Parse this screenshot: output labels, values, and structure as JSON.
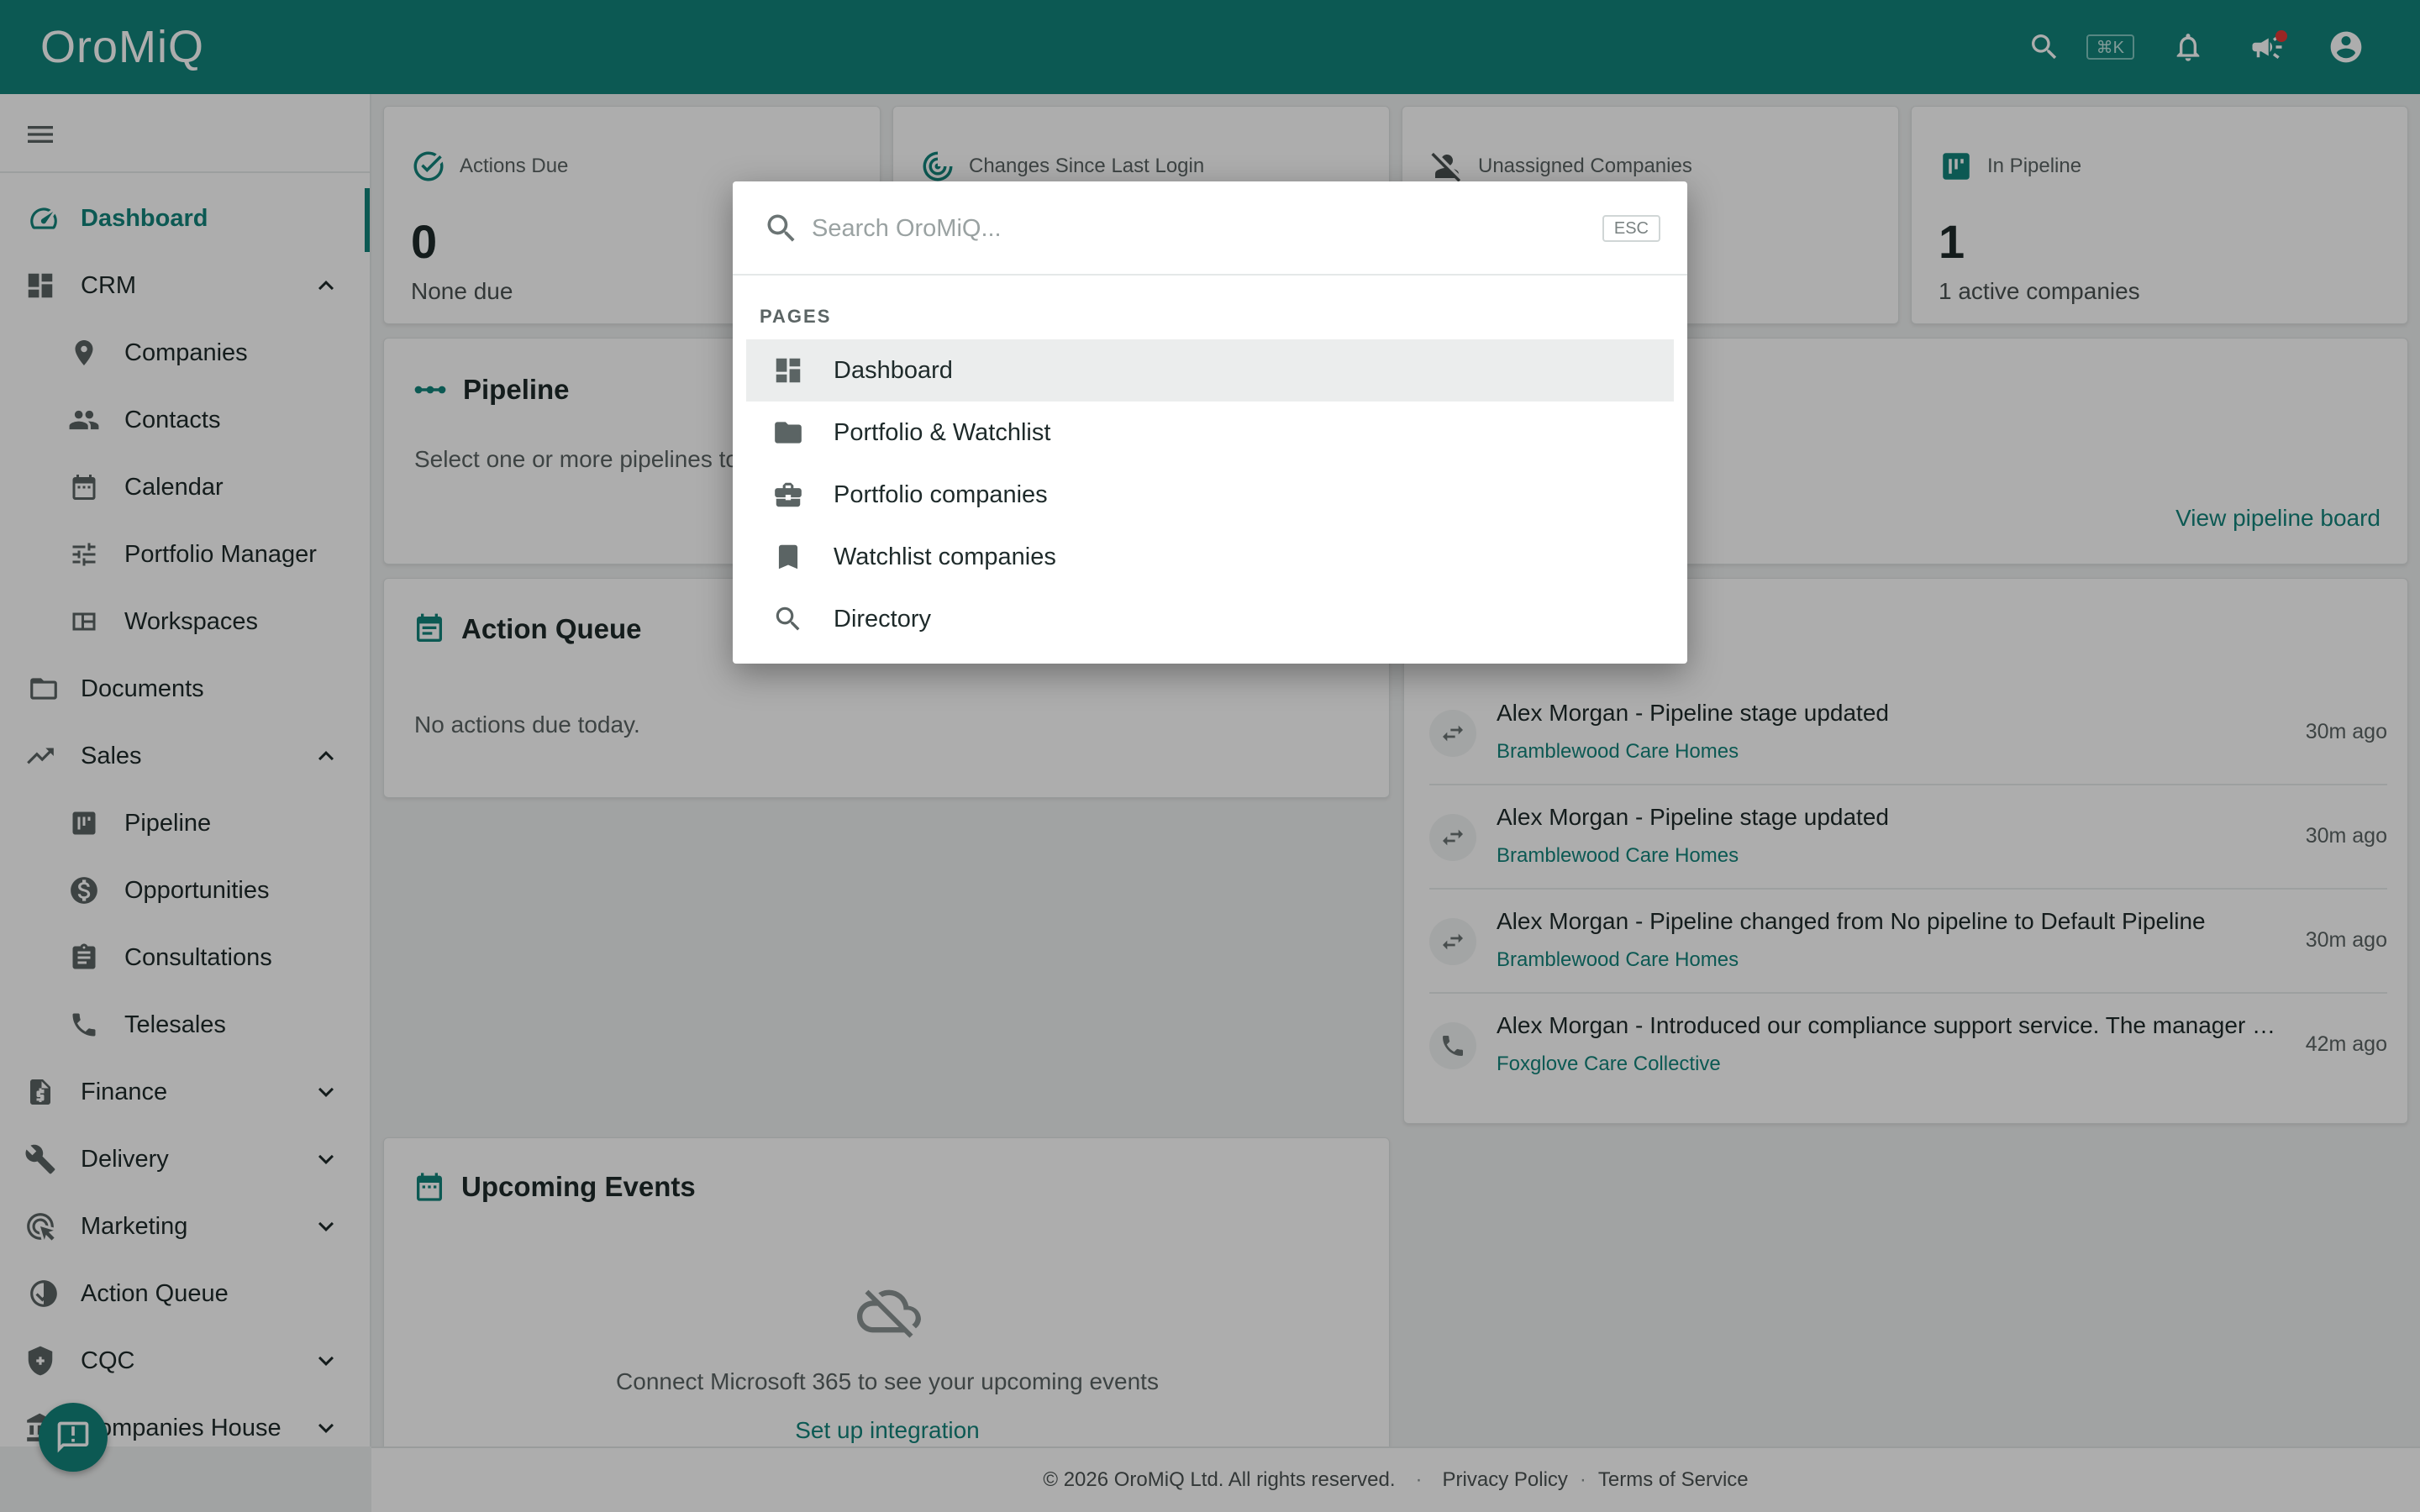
{
  "app": {
    "logo": "OroMiQ"
  },
  "topbar": {
    "shortcut": "⌘K"
  },
  "sidebar": {
    "items": [
      {
        "label": "Dashboard"
      },
      {
        "label": "CRM"
      },
      {
        "label": "Companies"
      },
      {
        "label": "Contacts"
      },
      {
        "label": "Calendar"
      },
      {
        "label": "Portfolio Manager"
      },
      {
        "label": "Workspaces"
      },
      {
        "label": "Documents"
      },
      {
        "label": "Sales"
      },
      {
        "label": "Pipeline"
      },
      {
        "label": "Opportunities"
      },
      {
        "label": "Consultations"
      },
      {
        "label": "Telesales"
      },
      {
        "label": "Finance"
      },
      {
        "label": "Delivery"
      },
      {
        "label": "Marketing"
      },
      {
        "label": "Action Queue"
      },
      {
        "label": "CQC"
      },
      {
        "label": "Companies House"
      }
    ]
  },
  "stats": [
    {
      "label": "Actions Due",
      "value": "0",
      "sub": "None due"
    },
    {
      "label": "Changes Since Last Login",
      "value": "",
      "sub": ""
    },
    {
      "label": "Unassigned Companies",
      "value": "",
      "sub": ""
    },
    {
      "label": "In Pipeline",
      "value": "1",
      "sub": "1 active companies"
    }
  ],
  "pipeline": {
    "title": "Pipeline",
    "text": "Select one or more pipelines to",
    "link": "View pipeline board"
  },
  "action_queue": {
    "title": "Action Queue",
    "text": "No actions due today."
  },
  "activity": [
    {
      "title": "Alex Morgan - Pipeline stage updated",
      "company": "Bramblewood Care Homes",
      "time": "30m ago",
      "icon": "swap-icon"
    },
    {
      "title": "Alex Morgan - Pipeline stage updated",
      "company": "Bramblewood Care Homes",
      "time": "30m ago",
      "icon": "swap-icon"
    },
    {
      "title": "Alex Morgan - Pipeline changed from No pipeline to Default Pipeline",
      "company": "Bramblewood Care Homes",
      "time": "30m ago",
      "icon": "swap-icon"
    },
    {
      "title": "Alex Morgan - Introduced our compliance support service. The manager …",
      "company": "Foxglove Care Collective",
      "time": "42m ago",
      "icon": "phone-icon"
    }
  ],
  "upcoming": {
    "title": "Upcoming Events",
    "text": "Connect Microsoft 365 to see your upcoming events",
    "link": "Set up integration"
  },
  "footer": {
    "copyright": "© 2026 OroMiQ Ltd. All rights reserved.",
    "privacy": "Privacy Policy",
    "terms": "Terms of Service"
  },
  "palette": {
    "placeholder": "Search OroMiQ...",
    "esc": "ESC",
    "section": "PAGES",
    "items": [
      {
        "label": "Dashboard",
        "icon": "dashboard-icon"
      },
      {
        "label": "Portfolio & Watchlist",
        "icon": "folder-icon"
      },
      {
        "label": "Portfolio companies",
        "icon": "briefcase-icon"
      },
      {
        "label": "Watchlist companies",
        "icon": "bookmark-icon"
      },
      {
        "label": "Directory",
        "icon": "search-icon"
      }
    ]
  },
  "colors": {
    "brand": "#13847b",
    "text": "#1e2a2a",
    "muted": "#5b6464"
  }
}
